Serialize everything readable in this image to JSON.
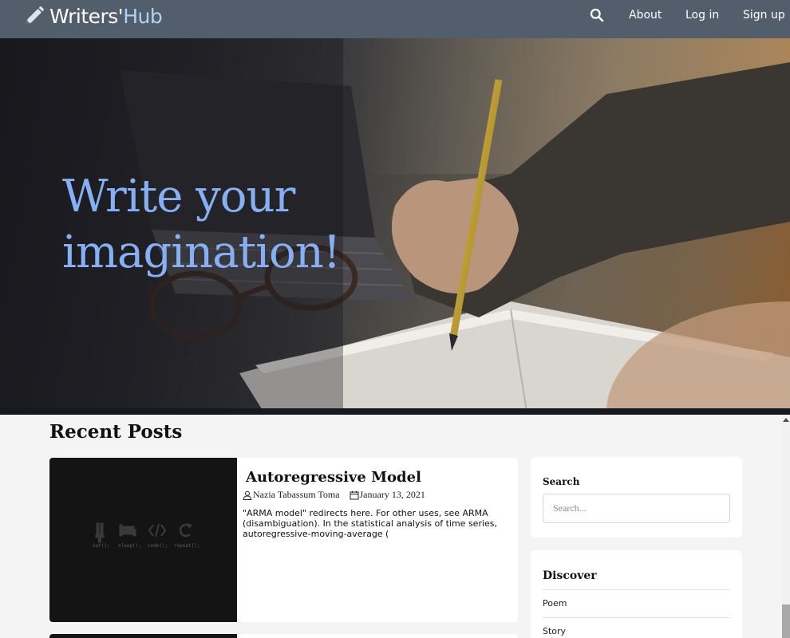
{
  "nav": {
    "brand_main": "Writers'",
    "brand_hub": "Hub",
    "brand_icon": "pencil-icon",
    "search_icon": "search-icon",
    "about": "About",
    "login": "Log in",
    "signup": "Sign up"
  },
  "hero": {
    "line1": "Write your",
    "line2": "imagination!"
  },
  "recent": {
    "title": "Recent Posts",
    "posts": [
      {
        "title": "Autoregressive Model",
        "author": "Nazia Tabassum Toma",
        "date": "January 13, 2021",
        "excerpt": "\"ARMA model\" redirects here. For other uses, see ARMA (disambiguation). In the statistical analysis of time series, autoregressive-moving-average (",
        "thumb_labels": [
          "eat();",
          "sleep();",
          "code();",
          "repeat();"
        ]
      }
    ]
  },
  "sidebar": {
    "search_label": "Search",
    "search_placeholder": "Search...",
    "discover_title": "Discover",
    "discover_items": [
      "Poem",
      "Story"
    ]
  },
  "colors": {
    "navbar": "#535e6d",
    "brand_hub": "#a9d6ef",
    "hero_text": "#86b0f6",
    "page_bg": "#f4f4f4"
  }
}
